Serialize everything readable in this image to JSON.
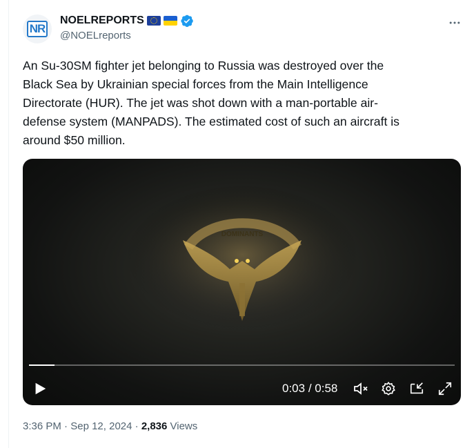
{
  "account": {
    "avatar_text": "NR",
    "display_name": "NOELREPORTS",
    "handle": "@NOELreports",
    "flags": [
      "eu-flag-icon",
      "ukraine-flag-icon"
    ],
    "verified": true
  },
  "tweet": {
    "text": "An Su-30SM fighter jet belonging to Russia was destroyed over the\nBlack Sea by Ukrainian special forces from the Main Intelligence\nDirectorate (HUR). The jet was shot down with a man-portable air-\ndefense system (MANPADS). The estimated cost of such an aircraft is\naround $50 million."
  },
  "video": {
    "current_time": "0:03",
    "separator": " / ",
    "duration": "0:58",
    "progress_fraction": 0.06,
    "emblem_text": "DOMINANTS"
  },
  "meta": {
    "time": "3:36 PM",
    "dot1": " · ",
    "date": "Sep 12, 2024",
    "dot2": " · ",
    "views_count": "2,836",
    "views_label": " Views"
  },
  "colors": {
    "accent": "#1d9bf0",
    "text_primary": "#0f1419",
    "text_secondary": "#536471"
  }
}
